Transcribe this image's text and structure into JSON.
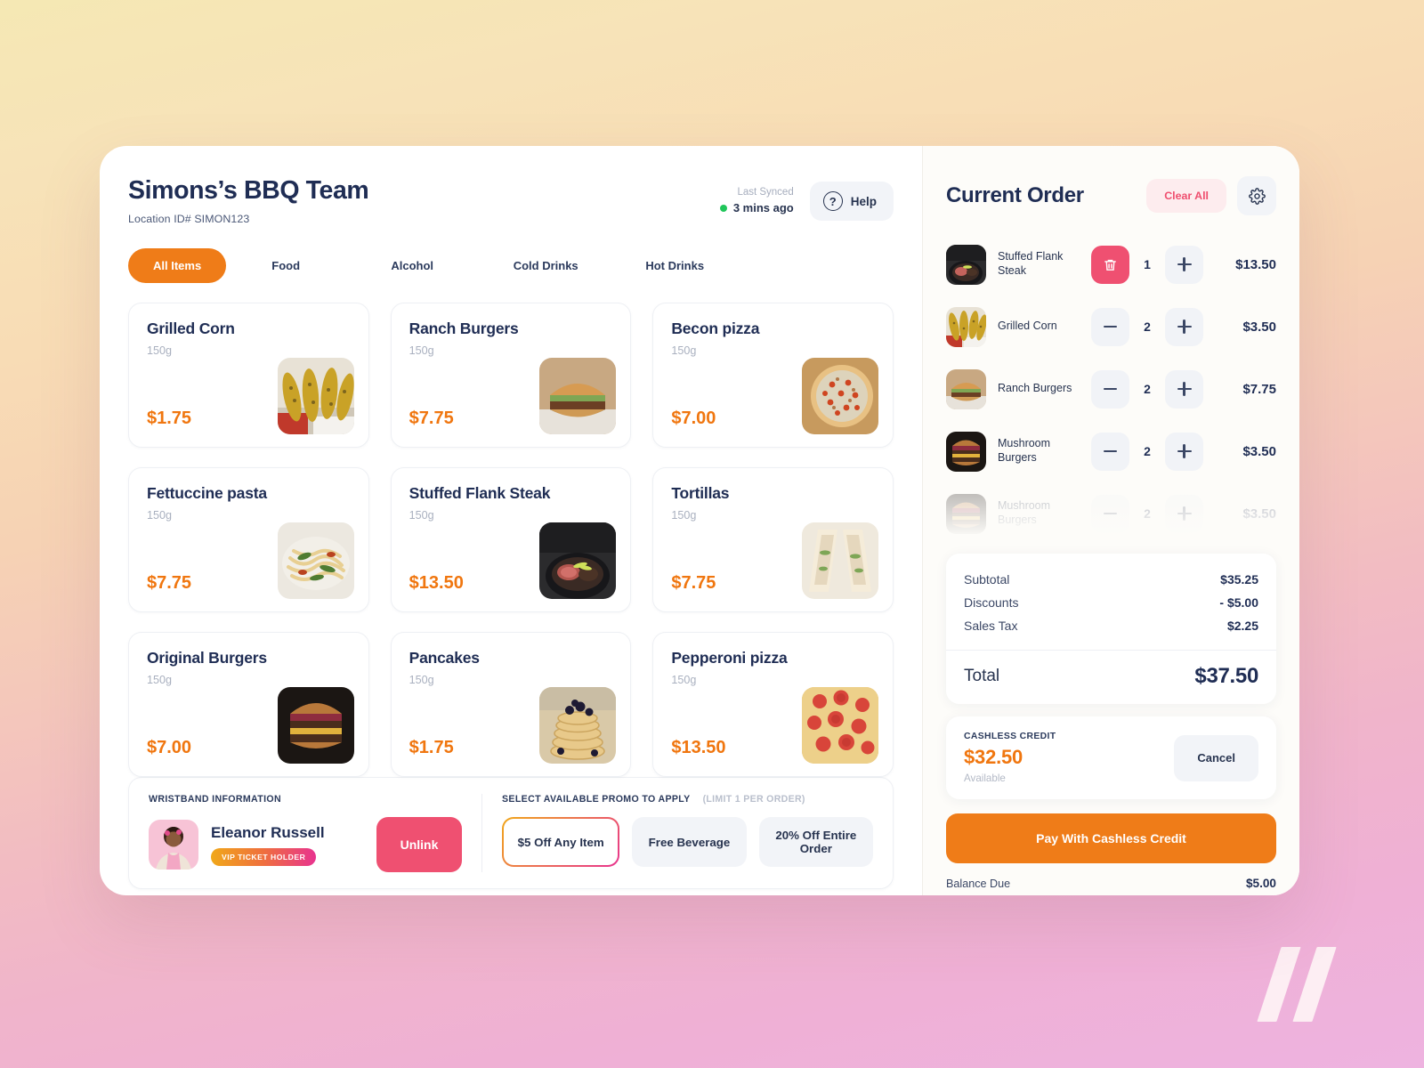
{
  "store": {
    "title": "Simons’s BBQ Team",
    "location": "Location ID# SIMON123"
  },
  "sync": {
    "label": "Last Synced",
    "value": "3 mins ago",
    "dot_color": "#20c65a"
  },
  "help": {
    "label": "Help",
    "icon": "question-icon",
    "glyph": "?"
  },
  "tabs": [
    {
      "label": "All Items",
      "active": true
    },
    {
      "label": "Food",
      "active": false
    },
    {
      "label": "Alcohol",
      "active": false
    },
    {
      "label": "Cold Drinks",
      "active": false
    },
    {
      "label": "Hot Drinks",
      "active": false
    }
  ],
  "products": [
    {
      "name": "Grilled Corn",
      "weight": "150g",
      "price": "$1.75",
      "image": "grilled-corn"
    },
    {
      "name": "Ranch Burgers",
      "weight": "150g",
      "price": "$7.75",
      "image": "ranch-burger"
    },
    {
      "name": "Becon pizza",
      "weight": "150g",
      "price": "$7.00",
      "image": "bacon-pizza"
    },
    {
      "name": "Fettuccine pasta",
      "weight": "150g",
      "price": "$7.75",
      "image": "pasta"
    },
    {
      "name": "Stuffed Flank Steak",
      "weight": "150g",
      "price": "$13.50",
      "image": "flank-steak"
    },
    {
      "name": "Tortillas",
      "weight": "150g",
      "price": "$7.75",
      "image": "tortillas"
    },
    {
      "name": "Original Burgers",
      "weight": "150g",
      "price": "$7.00",
      "image": "original-burger"
    },
    {
      "name": "Pancakes",
      "weight": "150g",
      "price": "$1.75",
      "image": "pancakes"
    },
    {
      "name": "Pepperoni pizza",
      "weight": "150g",
      "price": "$13.50",
      "image": "pepperoni-pizza"
    }
  ],
  "wristband": {
    "section_label": "WRISTBAND INFORMATION",
    "name": "Eleanor Russell",
    "badge": "VIP TICKET HOLDER",
    "unlink_label": "Unlink"
  },
  "promo": {
    "section_label": "SELECT AVAILABLE PROMO TO APPLY",
    "limit_note": "(LIMIT 1 PER ORDER)",
    "options": [
      {
        "label": "$5 Off Any Item",
        "selected": true
      },
      {
        "label": "Free Beverage",
        "selected": false
      },
      {
        "label": "20% Off Entire Order",
        "selected": false
      }
    ]
  },
  "order": {
    "title": "Current Order",
    "clear_label": "Clear All",
    "settings_icon": "gear-icon",
    "items": [
      {
        "name": "Stuffed Flank Steak",
        "qty": "1",
        "price": "$13.50",
        "image": "flank-steak",
        "left_action": "delete",
        "faded": false
      },
      {
        "name": "Grilled Corn",
        "qty": "2",
        "price": "$3.50",
        "image": "grilled-corn",
        "left_action": "minus",
        "faded": false
      },
      {
        "name": "Ranch Burgers",
        "qty": "2",
        "price": "$7.75",
        "image": "ranch-burger",
        "left_action": "minus",
        "faded": false
      },
      {
        "name": "Mushroom Burgers",
        "qty": "2",
        "price": "$3.50",
        "image": "original-burger",
        "left_action": "minus",
        "faded": false
      },
      {
        "name": "Mushroom Burgers",
        "qty": "2",
        "price": "$3.50",
        "image": "original-burger",
        "left_action": "minus",
        "faded": true
      }
    ],
    "totals": [
      {
        "key": "Subtotal",
        "value": "$35.25"
      },
      {
        "key": "Discounts",
        "value": "- $5.00"
      },
      {
        "key": "Sales Tax",
        "value": "$2.25"
      }
    ],
    "total_key": "Total",
    "total_value": "$37.50"
  },
  "credit": {
    "label": "CASHLESS CREDIT",
    "amount": "$32.50",
    "available": "Available",
    "cancel_label": "Cancel"
  },
  "pay_label": "Pay With Cashless Credit",
  "balance": {
    "key": "Balance Due",
    "value": "$5.00"
  },
  "colors": {
    "accent_orange": "#ef7c18",
    "price_orange": "#f0760f",
    "pink": "#ef5071",
    "navy": "#1f2d54",
    "green": "#20c65a"
  }
}
